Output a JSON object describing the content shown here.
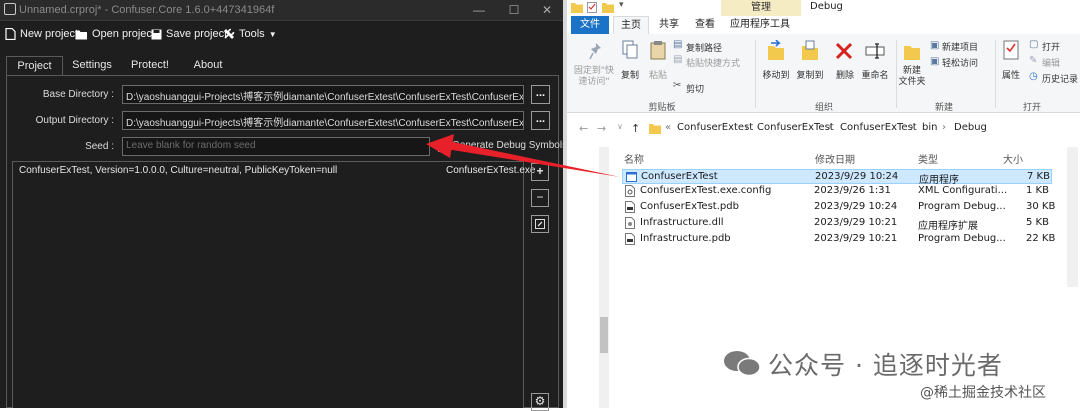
{
  "confuser": {
    "title": "Unnamed.crproj* - Confuser.Core 1.6.0+447341964f",
    "toolbar": {
      "new_project": "New project",
      "open_project": "Open project",
      "save_project": "Save project",
      "tools": "Tools"
    },
    "tabs": [
      "Project",
      "Settings",
      "Protect!",
      "About"
    ],
    "base_directory": {
      "label": "Base Directory :",
      "value": "D:\\yaoshuanggui-Projects\\搏客示例diamante\\ConfuserExtest\\ConfuserExTest\\ConfuserExTest\\bin\\Debu",
      "button": "..."
    },
    "output_directory": {
      "label": "Output Directory :",
      "value": "D:\\yaoshuanggui-Projects\\搏客示例diamante\\ConfuserExtest\\ConfuserExTest\\ConfuserExTest\\bin\\Debu",
      "button": "..."
    },
    "seed": {
      "label": "Seed :",
      "placeholder": "Leave blank for random seed"
    },
    "debug_symbols_label": "Generate Debug Symbols",
    "assemblies": [
      {
        "name": "ConfuserExTest, Version=1.0.0.0, Culture=neutral, PublicKeyToken=null",
        "file": "ConfuserExTest.exe"
      }
    ],
    "side_buttons": {
      "add": "+",
      "remove": "−"
    }
  },
  "explorer": {
    "context_tab": "管理",
    "window_title": "Debug",
    "tabs": {
      "file": "文件",
      "home": "主页",
      "share": "共享",
      "view": "查看",
      "app_tools": "应用程序工具"
    },
    "ribbon": {
      "pin": "固定到\"快\n速访问\"",
      "copy": "复制",
      "paste": "粘贴",
      "copy_path": "复制路径",
      "paste_shortcut": "粘贴快捷方式",
      "cut": "剪切",
      "clipboard": "剪贴板",
      "move_to": "移动到",
      "copy_to": "复制到",
      "delete": "删除",
      "rename": "重命名",
      "organize": "组织",
      "new_folder": "新建\n文件夹",
      "new_item": "新建项目",
      "easy_access": "轻松访问",
      "new": "新建",
      "properties": "属性",
      "open": "打开",
      "edit": "编辑",
      "history": "历史记录",
      "open_group": "打开"
    },
    "breadcrumb": [
      "ConfuserExtest",
      "ConfuserExTest",
      "ConfuserExTest",
      "bin",
      "Debug"
    ],
    "breadcrumb_prefix": "«",
    "columns": {
      "name": "名称",
      "modified": "修改日期",
      "type": "类型",
      "size": "大小"
    },
    "files": [
      {
        "name": "ConfuserExTest",
        "modified": "2023/9/29 10:24",
        "type": "应用程序",
        "size": "7 KB",
        "icon": "app-icon"
      },
      {
        "name": "ConfuserExTest.exe.config",
        "modified": "2023/9/26 1:31",
        "type": "XML Configurati...",
        "size": "1 KB",
        "icon": "config-file-icon"
      },
      {
        "name": "ConfuserExTest.pdb",
        "modified": "2023/9/29 10:24",
        "type": "Program Debug...",
        "size": "30 KB",
        "icon": "pdb-file-icon"
      },
      {
        "name": "Infrastructure.dll",
        "modified": "2023/9/29 10:21",
        "type": "应用程序扩展",
        "size": "5 KB",
        "icon": "dll-file-icon"
      },
      {
        "name": "Infrastructure.pdb",
        "modified": "2023/9/29 10:21",
        "type": "Program Debug...",
        "size": "22 KB",
        "icon": "pdb-file-icon"
      }
    ]
  },
  "watermark": {
    "line1": "公众号 · 追逐时光者",
    "line2": "@稀土掘金技术社区"
  },
  "colors": {
    "arrow": "#e8202a",
    "file_tab": "#1a73c7",
    "selection": "#cde8ff"
  }
}
